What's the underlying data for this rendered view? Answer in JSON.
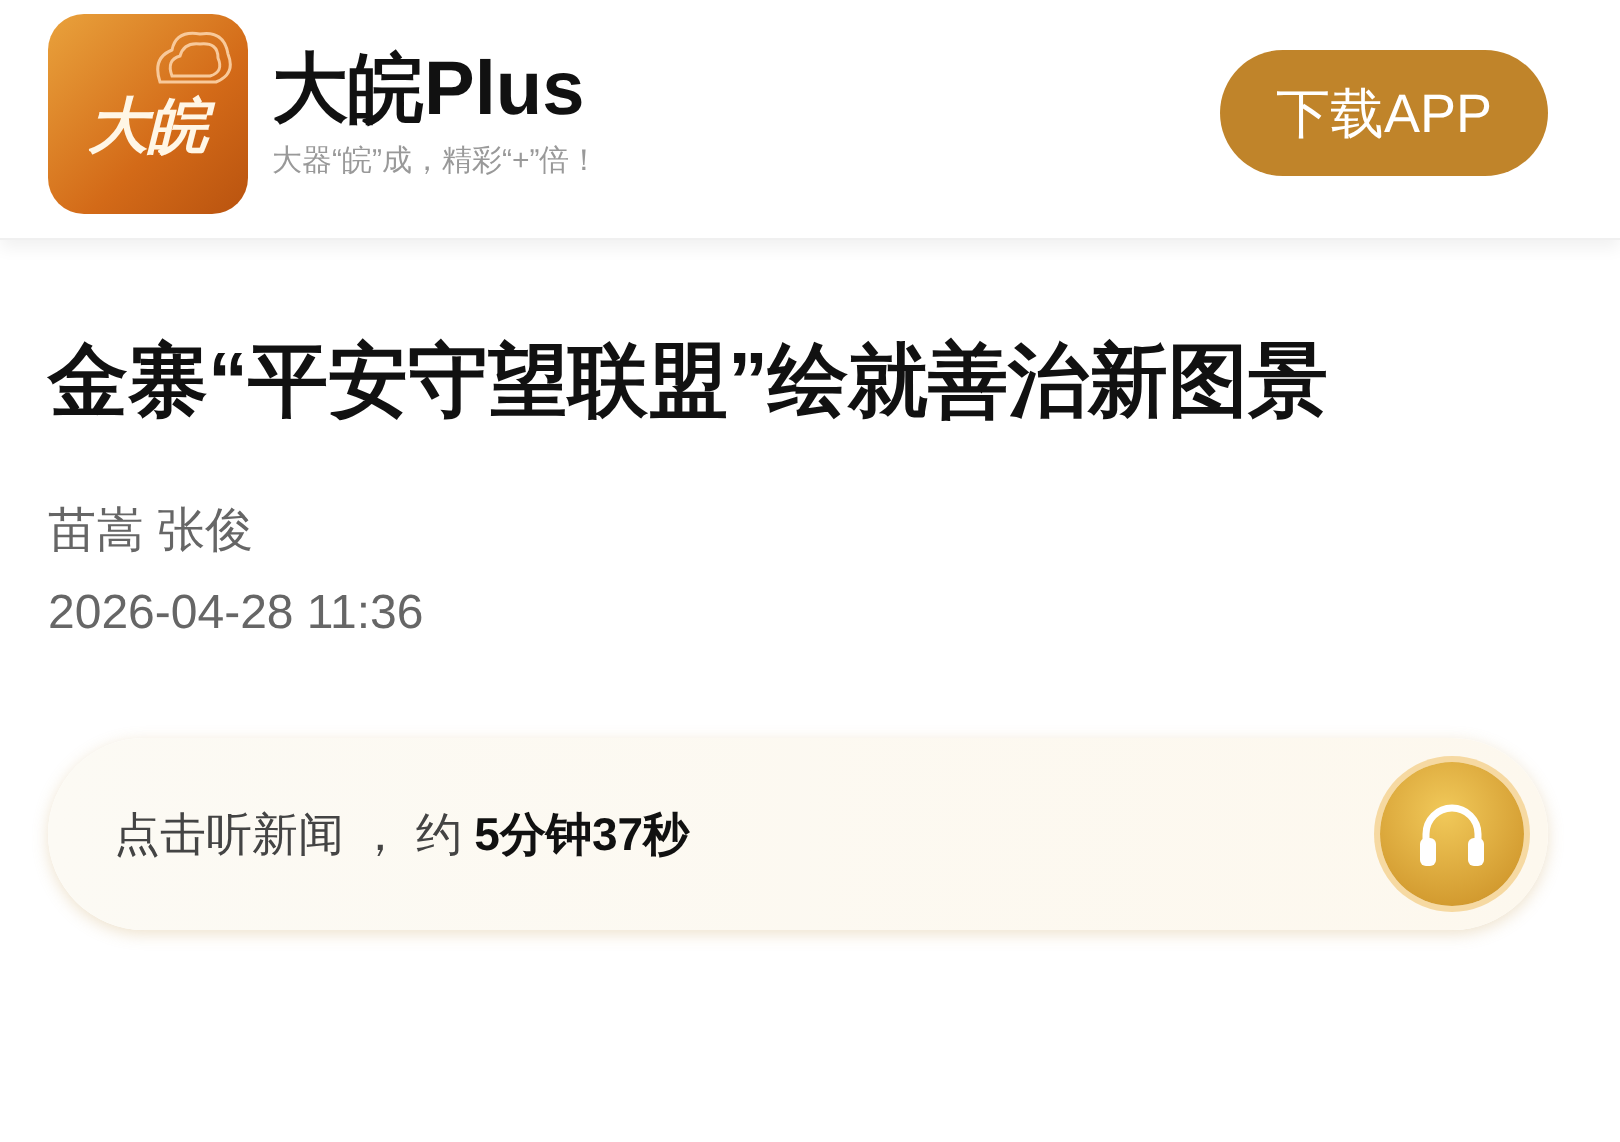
{
  "header": {
    "logo_text": "大皖",
    "app_name": "大皖Plus",
    "slogan": "大器“皖”成，精彩“+”倍！",
    "download_button": "下载APP"
  },
  "article": {
    "title": "金寨“平安守望联盟”绘就善治新图景",
    "authors": "苗嵩 张俊",
    "date": "2026-04-28 11:36"
  },
  "audio_bar": {
    "text": "点击听新闻 ， 约 **5分钟37秒**"
  }
}
